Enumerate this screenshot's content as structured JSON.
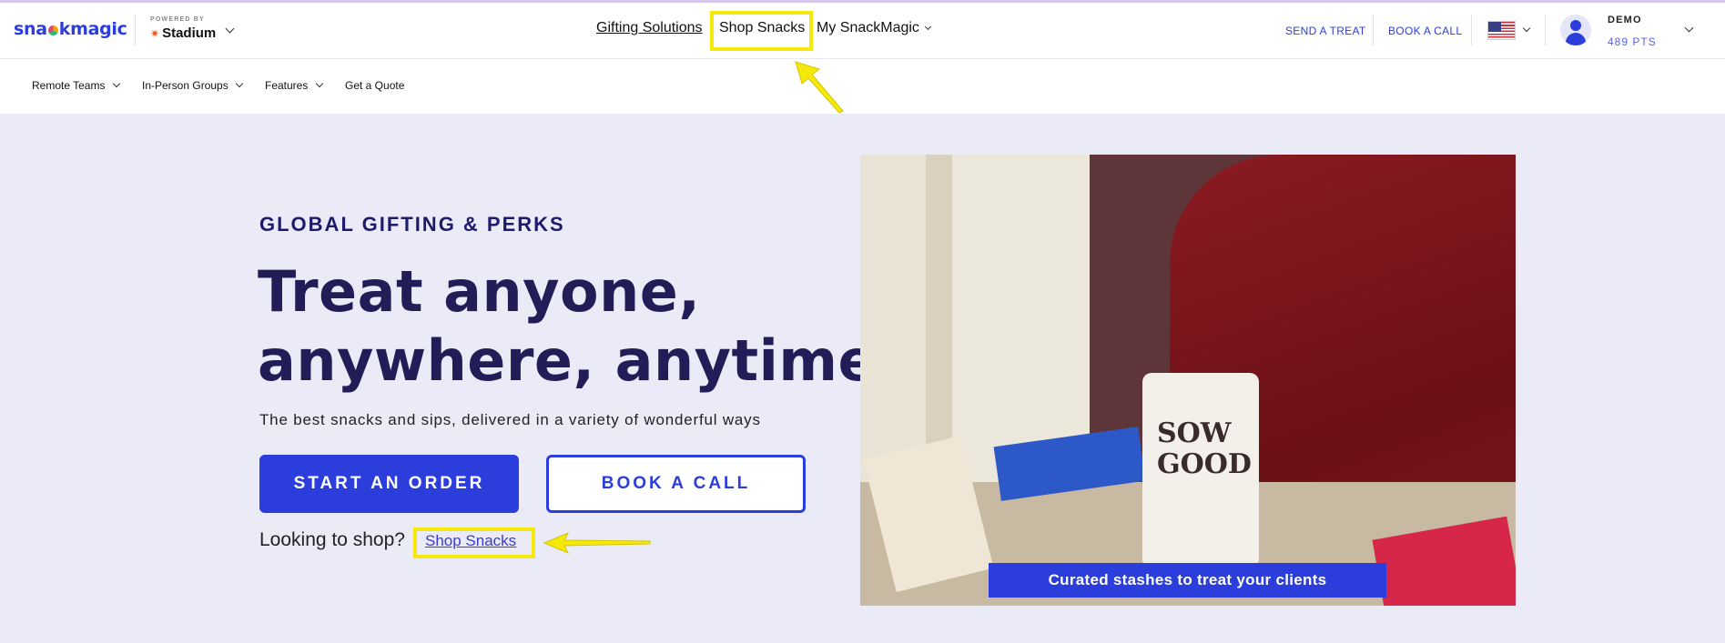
{
  "header": {
    "logo_text": "snackmagic",
    "powered_by": "POWERED BY",
    "partner": "Stadium",
    "nav": {
      "gifting": "Gifting Solutions",
      "shop": "Shop Snacks",
      "my": "My SnackMagic"
    },
    "send_treat": "SEND A TREAT",
    "book_call": "BOOK A CALL",
    "flag_icon": "us-flag-icon",
    "user_name": "DEMO",
    "points": "489 PTS"
  },
  "subnav": {
    "items": [
      "Remote Teams",
      "In-Person Groups",
      "Features",
      "Get a Quote"
    ]
  },
  "hero": {
    "eyebrow": "GLOBAL GIFTING & PERKS",
    "headline_line1": "Treat anyone,",
    "headline_line2": "anywhere, anytime",
    "subtext": "The best snacks and sips, delivered in a variety of wonderful ways",
    "primary_cta": "START AN ORDER",
    "secondary_cta": "BOOK A CALL",
    "looking_text": "Looking to shop?",
    "shop_link": "Shop Snacks",
    "image_caption": "Curated stashes to treat your clients"
  },
  "image_text": {
    "bag_line1": "SOW",
    "bag_line2": "GOOD"
  },
  "colors": {
    "brand_blue": "#2b3ddb",
    "hero_bg": "#ebebf8",
    "highlight": "#f5e90c",
    "heading": "#221d57"
  }
}
